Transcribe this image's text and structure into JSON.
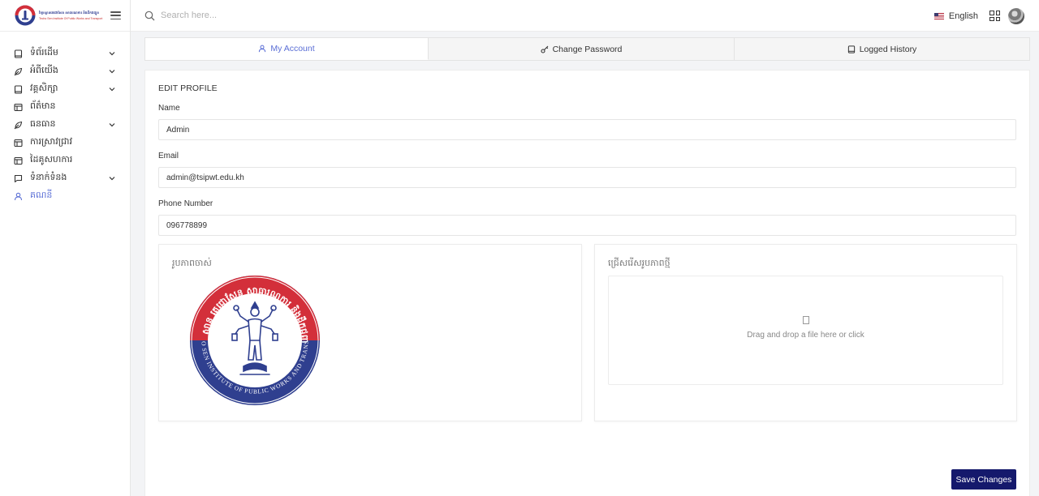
{
  "brand": {
    "line1": "វិទ្យាស្ថានតេជោសែន សាធារណការ និងដឹកជញ្ជូន",
    "line2": "Techo Sen Institute Of Public Works and Transport"
  },
  "sidebar": {
    "items": [
      {
        "label": "ទំព័រដើម",
        "icon": "book-icon",
        "has_children": true
      },
      {
        "label": "អំពីយើង",
        "icon": "leaf-icon",
        "has_children": true
      },
      {
        "label": "វគ្គសិក្សា",
        "icon": "book-icon",
        "has_children": true
      },
      {
        "label": "ព័ត៌មាន",
        "icon": "layout-icon",
        "has_children": false
      },
      {
        "label": "ធនធាន",
        "icon": "leaf-icon",
        "has_children": true
      },
      {
        "label": "ការស្រាវជ្រាវ",
        "icon": "layout-icon",
        "has_children": false
      },
      {
        "label": "ដៃគូសហការ",
        "icon": "layout-icon",
        "has_children": false
      },
      {
        "label": "ទំនាក់ទំនង",
        "icon": "chat-icon",
        "has_children": true
      },
      {
        "label": "គណនី",
        "icon": "user-icon",
        "has_children": false,
        "active": true
      }
    ]
  },
  "topbar": {
    "search_placeholder": "Search here...",
    "language": "English"
  },
  "tabs": [
    {
      "label": "My Account",
      "icon": "user-icon",
      "active": true
    },
    {
      "label": "Change Password",
      "icon": "key-icon",
      "active": false
    },
    {
      "label": "Logged History",
      "icon": "book-icon",
      "active": false
    }
  ],
  "profile": {
    "section_title": "EDIT PROFILE",
    "name_label": "Name",
    "name_value": "Admin",
    "email_label": "Email",
    "email_value": "admin@tsipwt.edu.kh",
    "phone_label": "Phone Number",
    "phone_value": "096778899",
    "old_image_title": "រូបភាពចាស់",
    "new_image_title": "ជ្រើសរើសរូបភាពថ្មី",
    "dropzone_text": "Drag and drop a file here or click",
    "save_label": "Save Changes"
  },
  "seal": {
    "top_text": "វិទ្យាស្ថាន តេជោសែន សាធារណការ និងដឹកជញ្ជូន",
    "bottom_text": "TECHO SEN INSTITUTE OF PUBLIC WORKS AND TRANSPORT"
  },
  "colors": {
    "accent": "#5b6fd6",
    "save_button": "#15196c",
    "seal_red": "#d32f3a",
    "seal_blue": "#2f3f8f"
  }
}
